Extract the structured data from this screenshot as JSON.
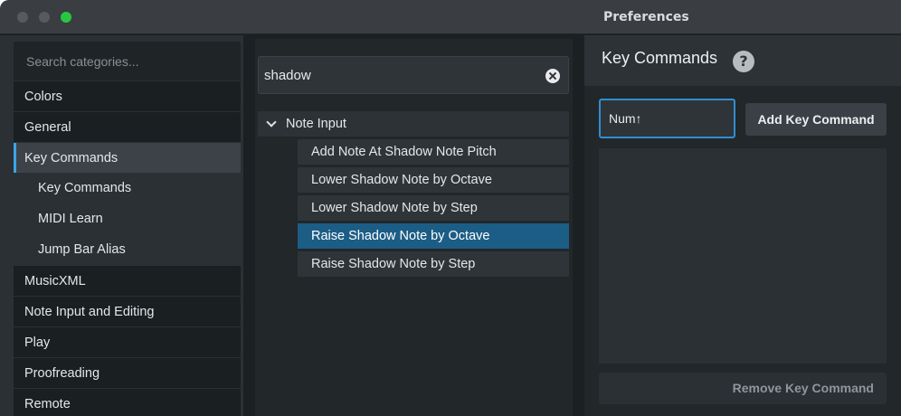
{
  "window": {
    "title": "Preferences"
  },
  "categories": {
    "search_placeholder": "Search categories...",
    "items": [
      {
        "label": "Colors"
      },
      {
        "label": "General"
      },
      {
        "label": "Key Commands"
      },
      {
        "label": "Key Commands"
      },
      {
        "label": "MIDI Learn"
      },
      {
        "label": "Jump Bar Alias"
      },
      {
        "label": "MusicXML"
      },
      {
        "label": "Note Input and Editing"
      },
      {
        "label": "Play"
      },
      {
        "label": "Proofreading"
      },
      {
        "label": "Remote"
      }
    ]
  },
  "commands": {
    "filter_value": "shadow",
    "group": {
      "label": "Note Input"
    },
    "items": [
      {
        "label": "Add Note At Shadow Note Pitch"
      },
      {
        "label": "Lower Shadow Note by Octave"
      },
      {
        "label": "Lower Shadow Note by Step"
      },
      {
        "label": "Raise Shadow Note by Octave"
      },
      {
        "label": "Raise Shadow Note by Step"
      }
    ]
  },
  "key_panel": {
    "title": "Key Commands",
    "help": "?",
    "key_value": "Num↑",
    "add_label": "Add Key Command",
    "remove_label": "Remove Key Command"
  },
  "colors": {
    "accent": "#2f8fd1",
    "selected_row": "#1c5d86",
    "traffic_green": "#27c840"
  }
}
